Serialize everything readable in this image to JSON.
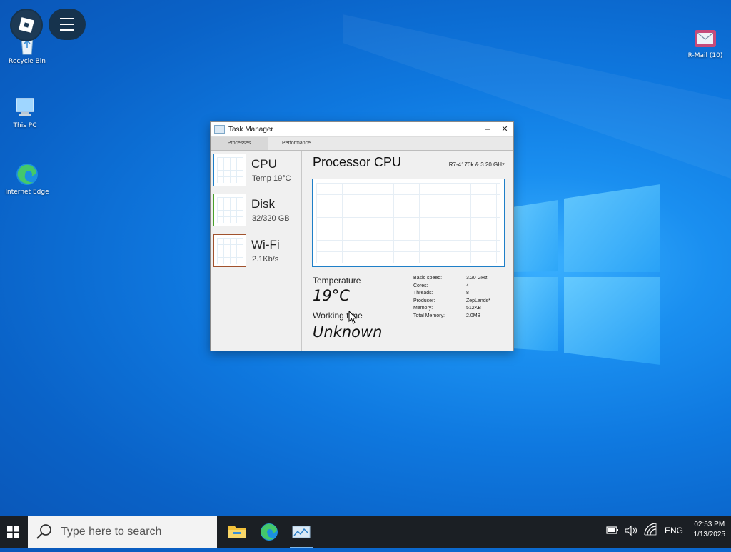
{
  "desktop": {
    "icons": [
      {
        "label": "Recycle Bin",
        "icon": "recycle-bin-icon"
      },
      {
        "label": "This PC",
        "icon": "computer-icon"
      },
      {
        "label": "Internet Edge",
        "icon": "edge-icon"
      },
      {
        "label": "R-Mail (10)",
        "icon": "mail-icon"
      }
    ]
  },
  "overlay": {
    "buttons": [
      {
        "icon": "roblox-icon"
      },
      {
        "icon": "hamburger-menu-icon"
      }
    ]
  },
  "task_manager": {
    "title": "Task Manager",
    "controls": {
      "minimize": "–",
      "close": "✕"
    },
    "tabs": [
      {
        "label": "Processes",
        "active": true
      },
      {
        "label": "Performance",
        "active": false
      }
    ],
    "sidebar": [
      {
        "name": "CPU",
        "sub": "Temp 19°C",
        "color": "#1f7fc8"
      },
      {
        "name": "Disk",
        "sub": "32/320 GB",
        "color": "#4aa02c"
      },
      {
        "name": "Wi-Fi",
        "sub": "2.1Kb/s",
        "color": "#a0522d"
      }
    ],
    "main": {
      "title": "Processor CPU",
      "model": "R7-4170k & 3.20 GHz",
      "temperature_label": "Temperature",
      "temperature_value": "19°C",
      "working_time_label": "Working time",
      "working_time_value": "Unknown",
      "specs": [
        {
          "key": "Basic speed:",
          "value": "3.20 GHz"
        },
        {
          "key": "Cores:",
          "value": "4"
        },
        {
          "key": "Threads:",
          "value": "8"
        },
        {
          "key": "Producer:",
          "value": "ZepLands*"
        },
        {
          "key": "Memory:",
          "value": "512KB"
        },
        {
          "key": "Total Memory:",
          "value": "2.0MB"
        }
      ]
    }
  },
  "taskbar": {
    "search_placeholder": "Type here to search",
    "apps": [
      {
        "icon": "file-explorer-icon",
        "active": false
      },
      {
        "icon": "edge-icon",
        "active": false
      },
      {
        "icon": "task-manager-icon",
        "active": true
      }
    ],
    "tray": {
      "language": "ENG",
      "time": "02:53 PM",
      "date": "1/13/2025"
    }
  }
}
